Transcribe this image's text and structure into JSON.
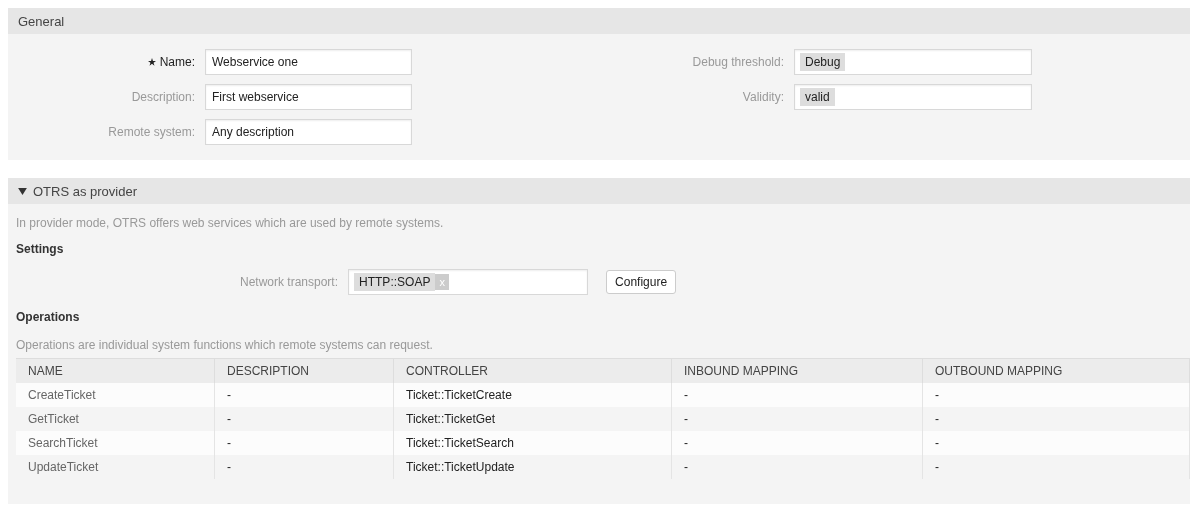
{
  "general": {
    "title": "General",
    "left_fields": [
      {
        "label": "Name:",
        "value": "Webservice one",
        "required": true
      },
      {
        "label": "Description:",
        "value": "First webservice",
        "required": false
      },
      {
        "label": "Remote system:",
        "value": "Any description",
        "required": false
      }
    ],
    "right_fields": [
      {
        "label": "Debug threshold:",
        "token": "Debug"
      },
      {
        "label": "Validity:",
        "token": "valid"
      }
    ]
  },
  "provider": {
    "title": "OTRS as provider",
    "expanded": true,
    "intro": "In provider mode, OTRS offers web services which are used by remote systems.",
    "settings_heading": "Settings",
    "transport": {
      "label": "Network transport:",
      "token": "HTTP::SOAP",
      "remove": "x",
      "button": "Configure"
    },
    "operations_heading": "Operations",
    "operations_intro": "Operations are individual system functions which remote systems can request.",
    "table": {
      "columns": [
        "NAME",
        "DESCRIPTION",
        "CONTROLLER",
        "INBOUND MAPPING",
        "OUTBOUND MAPPING"
      ],
      "rows": [
        [
          "CreateTicket",
          "-",
          "Ticket::TicketCreate",
          "-",
          "-"
        ],
        [
          "GetTicket",
          "-",
          "Ticket::TicketGet",
          "-",
          "-"
        ],
        [
          "SearchTicket",
          "-",
          "Ticket::TicketSearch",
          "-",
          "-"
        ],
        [
          "UpdateTicket",
          "-",
          "Ticket::TicketUpdate",
          "-",
          "-"
        ]
      ]
    }
  }
}
